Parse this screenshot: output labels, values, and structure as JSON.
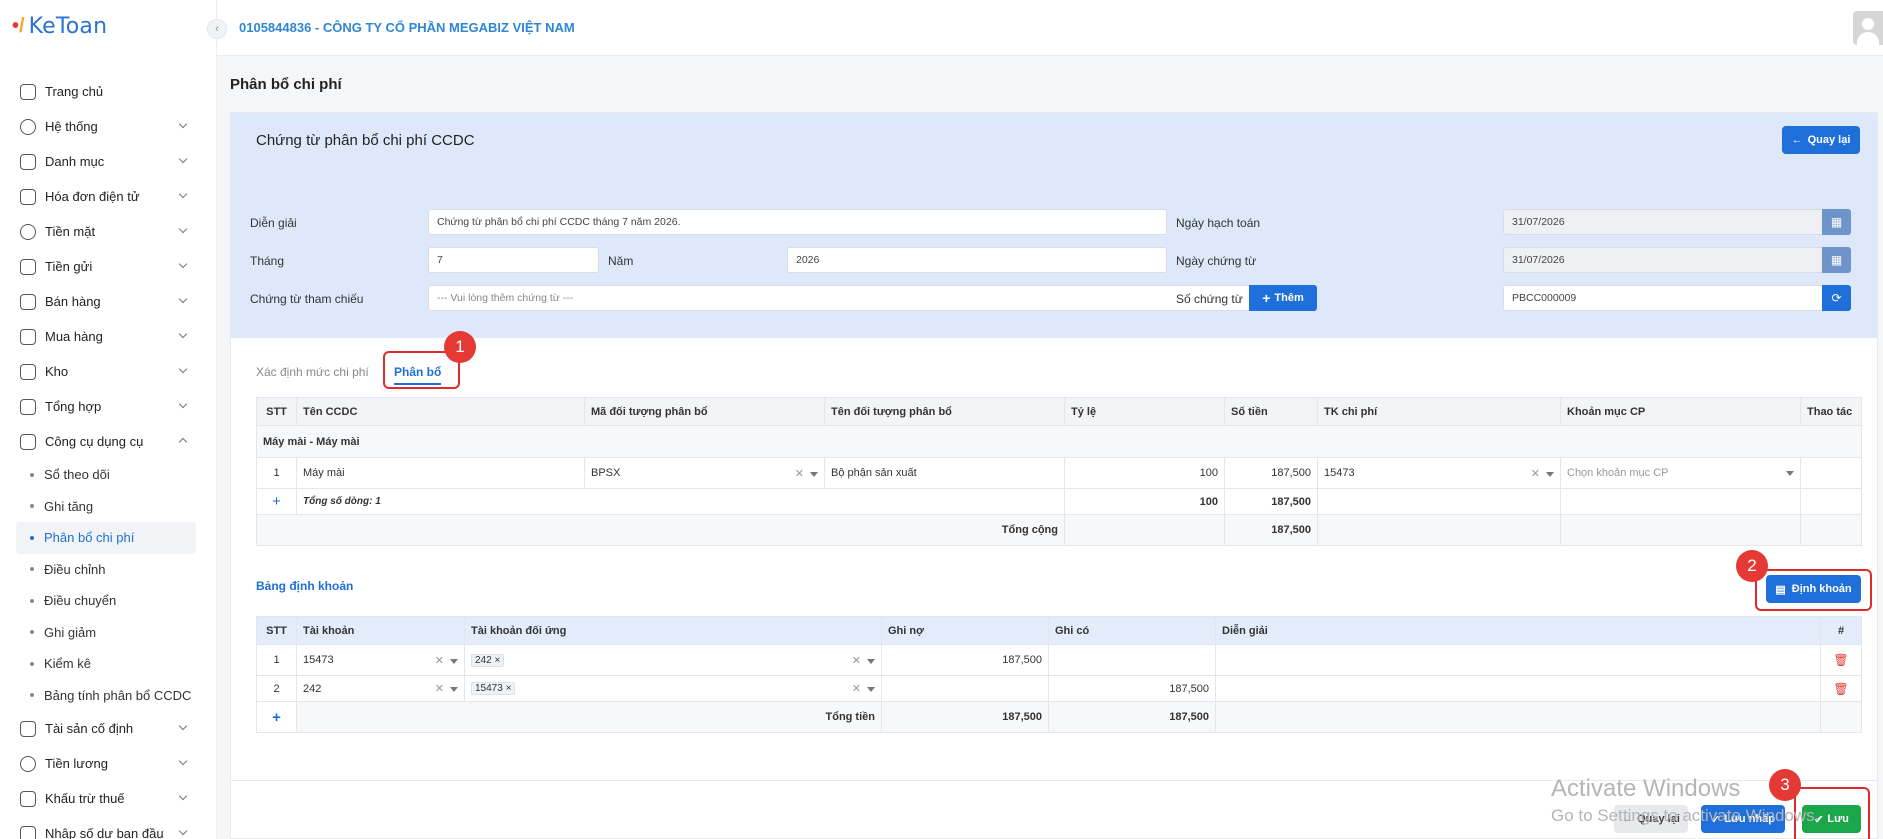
{
  "app": {
    "logo_text": "KeToan"
  },
  "header": {
    "company": "0105844836 - CÔNG TY CỔ PHẦN MEGABIZ VIỆT NAM"
  },
  "sidebar": {
    "items": [
      {
        "label": "Trang chủ",
        "icon": "home-icon"
      },
      {
        "label": "Hệ thống",
        "icon": "gear-icon"
      },
      {
        "label": "Danh mục",
        "icon": "grid-icon"
      },
      {
        "label": "Hóa đơn điện tử",
        "icon": "invoice-icon"
      },
      {
        "label": "Tiền mặt",
        "icon": "cash-icon"
      },
      {
        "label": "Tiền gửi",
        "icon": "bank-card-icon"
      },
      {
        "label": "Bán hàng",
        "icon": "shop-icon"
      },
      {
        "label": "Mua hàng",
        "icon": "cart-icon"
      },
      {
        "label": "Kho",
        "icon": "warehouse-icon"
      },
      {
        "label": "Tổng hợp",
        "icon": "chart-icon"
      },
      {
        "label": "Công cụ dụng cụ",
        "icon": "tools-icon"
      }
    ],
    "sub_items": [
      "Sổ theo dõi",
      "Ghi tăng",
      "Phân bổ chi phí",
      "Điều chỉnh",
      "Điều chuyển",
      "Ghi giảm",
      "Kiểm kê",
      "Bảng tính phân bổ CCDC"
    ],
    "items_after": [
      {
        "label": "Tài sản cố định",
        "icon": "car-icon"
      },
      {
        "label": "Tiền lương",
        "icon": "dollar-icon"
      },
      {
        "label": "Khấu trừ thuế",
        "icon": "bank-icon"
      },
      {
        "label": "Nhập số dư ban đầu",
        "icon": "import-icon"
      }
    ]
  },
  "page": {
    "title": "Phân bổ chi phí",
    "card_title": "Chứng từ phân bổ chi phí CCDC",
    "back_button": "Quay lại"
  },
  "form": {
    "dien_giai_label": "Diễn giải",
    "dien_giai_value": "Chứng từ phân bổ chi phí CCDC tháng 7 năm 2026.",
    "thang_label": "Tháng",
    "thang_value": "7",
    "nam_label": "Năm",
    "nam_value": "2026",
    "chung_tu_tham_chieu_label": "Chứng từ tham chiếu",
    "chung_tu_tham_chieu_placeholder": "--- Vui lòng thêm chứng từ ---",
    "them_button": "Thêm",
    "ngay_hach_toan_label": "Ngày hạch toán",
    "ngay_hach_toan_value": "31/07/2026",
    "ngay_chung_tu_label": "Ngày chứng từ",
    "ngay_chung_tu_value": "31/07/2026",
    "so_chung_tu_label": "Số chứng từ",
    "so_chung_tu_value": "PBCC000009"
  },
  "tabs": {
    "tab1": "Xác định mức chi phí",
    "tab2": "Phân bổ"
  },
  "callouts": [
    "1",
    "2",
    "3"
  ],
  "allocation_table": {
    "headers": [
      "STT",
      "Tên CCDC",
      "Mã đối tượng phân bổ",
      "Tên đối tượng phân bổ",
      "Tỷ lệ",
      "Số tiền",
      "TK chi phí",
      "Khoản mục CP",
      "Thao tác"
    ],
    "group": "Máy mài - Máy mài",
    "row": {
      "stt": "1",
      "ten": "Máy mài",
      "ma": "BPSX",
      "ten_doi_tuong": "Bộ phận sản xuất",
      "ty_le": "100",
      "so_tien": "187,500",
      "tk": "15473",
      "khoan_muc_placeholder": "Chọn khoản mục CP"
    },
    "summary": {
      "plus": "+",
      "label": "Tổng số dòng: 1",
      "ty_le": "100",
      "so_tien": "187,500"
    },
    "total": {
      "label": "Tổng cộng",
      "so_tien": "187,500"
    }
  },
  "entry_section": {
    "title": "Bảng định khoản",
    "button": "Định khoản"
  },
  "entry_table": {
    "headers": [
      "STT",
      "Tài khoản",
      "Tài khoản đối ứng",
      "Ghi nợ",
      "Ghi có",
      "Diễn giải",
      "#"
    ],
    "rows": [
      {
        "stt": "1",
        "tk": "15473",
        "doi_ung": "242",
        "no": "187,500",
        "co": ""
      },
      {
        "stt": "2",
        "tk": "242",
        "doi_ung": "15473",
        "no": "",
        "co": "187,500"
      }
    ],
    "total": {
      "plus": "+",
      "label": "Tổng tiền",
      "no": "187,500",
      "co": "187,500"
    }
  },
  "footer": {
    "back": "Quay lại",
    "draft": "Lưu nháp",
    "save": "Lưu"
  },
  "watermark": {
    "line1": "Activate Windows",
    "line2": "Go to Settings to activate Windows."
  }
}
